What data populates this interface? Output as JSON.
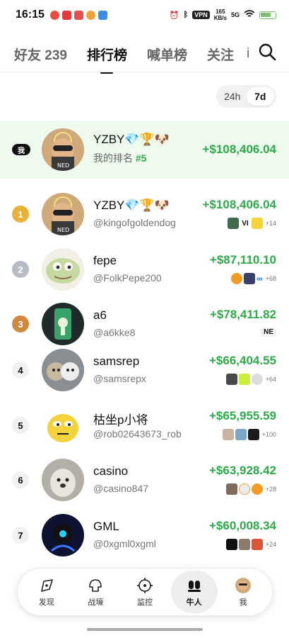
{
  "status_bar": {
    "time": "16:15",
    "vpn": "VPN",
    "net_speed_value": "165",
    "net_speed_unit": "KB/s",
    "signal": "5G"
  },
  "tabs": [
    {
      "label": "好友 239",
      "active": false
    },
    {
      "label": "排行榜",
      "active": true
    },
    {
      "label": "喊单榜",
      "active": false
    },
    {
      "label": "关注",
      "active": false
    }
  ],
  "tab_more": "i",
  "period": {
    "options": [
      "24h",
      "7d"
    ],
    "selected": "7d"
  },
  "me_row": {
    "badge": "我",
    "name": "YZBY💎🏆🐶",
    "rank_label": "我的排名",
    "rank_value": "#5",
    "pnl": "+$108,406.04"
  },
  "leaderboard": [
    {
      "rank": "1",
      "name": "YZBY💎🏆🐶",
      "handle": "@kingofgoldendog",
      "pnl": "+$108,406.04",
      "tokens_text": "VI",
      "more": "+14"
    },
    {
      "rank": "2",
      "name": "fepe",
      "handle": "@FolkPepe200",
      "pnl": "+$87,110.10",
      "more": "+68"
    },
    {
      "rank": "3",
      "name": "a6",
      "handle": "@a6kke8",
      "pnl": "+$78,411.82",
      "tokens_text": "NE"
    },
    {
      "rank": "4",
      "name": "samsrep",
      "handle": "@samsrepx",
      "pnl": "+$66,404.55",
      "more": "+64"
    },
    {
      "rank": "5",
      "name": "枯坐p小将",
      "handle": "@rob02643673_rob",
      "pnl": "+$65,955.59",
      "more": "+100"
    },
    {
      "rank": "6",
      "name": "casino",
      "handle": "@casino847",
      "pnl": "+$63,928.42",
      "more": "+28"
    },
    {
      "rank": "7",
      "name": "GML",
      "handle": "@0xgml0xgml",
      "pnl": "+$60,008.34",
      "more": "+24"
    }
  ],
  "bottom_nav": [
    {
      "label": "发现",
      "icon": "compass-icon",
      "active": false
    },
    {
      "label": "战壕",
      "icon": "trench-icon",
      "active": false
    },
    {
      "label": "监控",
      "icon": "crosshair-icon",
      "active": false
    },
    {
      "label": "牛人",
      "icon": "people-icon",
      "active": true
    },
    {
      "label": "我",
      "icon": "avatar-icon",
      "active": false
    }
  ],
  "colors": {
    "positive": "#2eaa4a",
    "highlight_bg": "#eefaee",
    "gold": "#e9b13a",
    "silver": "#b8bcc4",
    "bronze": "#d08a3e"
  }
}
